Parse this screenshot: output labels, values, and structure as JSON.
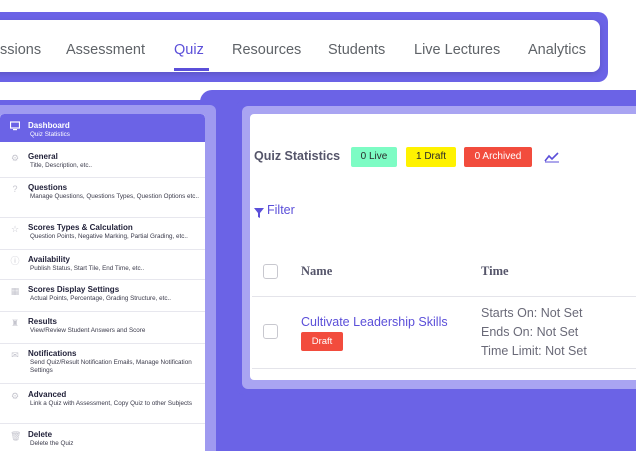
{
  "nav": {
    "tabs": [
      {
        "label": "ssions"
      },
      {
        "label": "Assessment"
      },
      {
        "label": "Quiz"
      },
      {
        "label": "Resources"
      },
      {
        "label": "Students"
      },
      {
        "label": "Live Lectures"
      },
      {
        "label": "Analytics"
      }
    ],
    "active_tab": "Quiz"
  },
  "sidebar": {
    "items": [
      {
        "title": "Dashboard",
        "subtitle": "Quiz Statistics",
        "icon": "monitor-icon",
        "active": true
      },
      {
        "title": "General",
        "subtitle": "Title, Description, etc..",
        "icon": "gear-icon"
      },
      {
        "title": "Questions",
        "subtitle": "Manage Questions, Questions Types, Question Options etc..",
        "icon": "question-icon"
      },
      {
        "title": "Scores Types & Calculation",
        "subtitle": "Question Points, Negative Marking, Partial Grading, etc..",
        "icon": "star-icon"
      },
      {
        "title": "Availability",
        "subtitle": "Publish Status, Start Tile, End Time, etc..",
        "icon": "info-icon"
      },
      {
        "title": "Scores Display Settings",
        "subtitle": "Actual Points, Percentage, Grading Structure, etc..",
        "icon": "grid-icon"
      },
      {
        "title": "Results",
        "subtitle": "View/Review Student Answers and Score",
        "icon": "trophy-icon"
      },
      {
        "title": "Notifications",
        "subtitle": "Send Quiz/Result Notification Emails, Manage Notification Settings",
        "icon": "envelope-icon"
      },
      {
        "title": "Advanced",
        "subtitle": "Link a Quiz with Assessment, Copy Quiz to other Subjects",
        "icon": "cogs-icon"
      },
      {
        "title": "Delete",
        "subtitle": "Delete the Quiz",
        "icon": "trash-icon"
      }
    ]
  },
  "stats": {
    "title": "Quiz Statistics",
    "live": "0 Live",
    "draft": "1 Draft",
    "archived": "0 Archived",
    "colors": {
      "live": "#7dfcc4",
      "draft": "#fff200",
      "archived": "#f24c3d",
      "accent": "#5b4fd9"
    }
  },
  "filter": {
    "label": "Filter"
  },
  "table": {
    "headers": {
      "name": "Name",
      "time": "Time"
    },
    "rows": [
      {
        "name": "Cultivate Leadership Skills",
        "status": "Draft",
        "starts_on": "Starts On: Not Set",
        "ends_on": "Ends On: Not Set",
        "time_limit": "Time Limit: Not Set"
      }
    ]
  }
}
